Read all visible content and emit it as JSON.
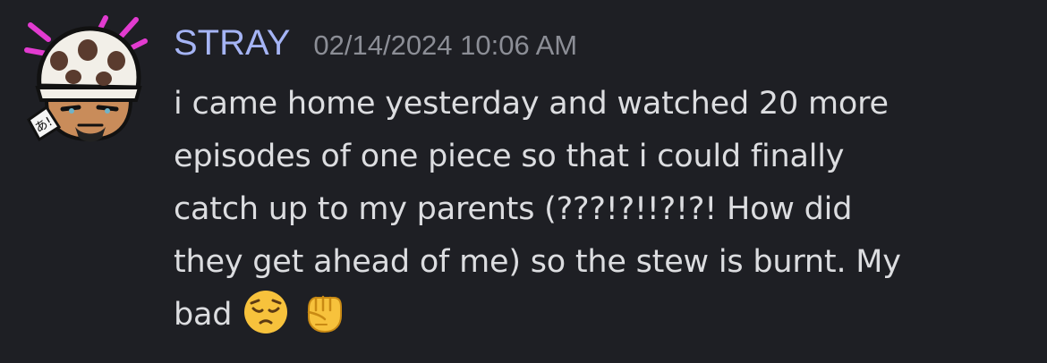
{
  "message": {
    "author": "STRAY",
    "timestamp": "02/14/2024 10:06 AM",
    "avatar_label": "あ!",
    "content_lines": [
      "i came home yesterday and watched 20 more",
      "episodes of one piece so that i could finally",
      "catch up to my parents (???!?!!?!?! How did",
      "they get ahead of me) so the stew is burnt. My",
      "bad"
    ],
    "emojis": [
      "pensive-face-emoji",
      "raised-fist-emoji"
    ]
  },
  "colors": {
    "background": "#1e1f24",
    "username": "#a5b4f5",
    "timestamp": "#8c8e96",
    "text": "#dcdde0",
    "avatar_accent": "#e23bd0"
  }
}
